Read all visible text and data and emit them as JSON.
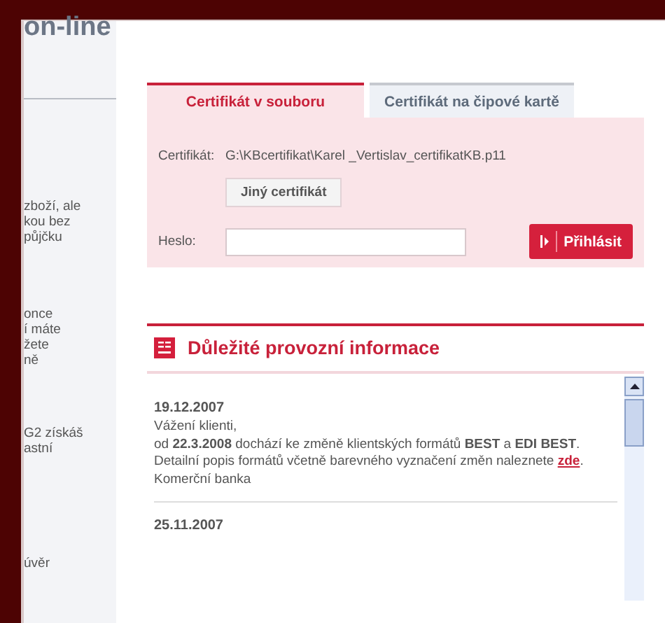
{
  "header": {
    "title": "on-line"
  },
  "sidebar": {
    "fragments": [
      {
        "lines": [
          "zboží, ale",
          "kou bez",
          "půjčku"
        ]
      },
      {
        "lines": [
          "once",
          "í máte",
          "žete",
          "ně"
        ]
      },
      {
        "lines": [
          "G2 získáš",
          "astní"
        ]
      },
      {
        "lines": [
          "úvěr"
        ]
      }
    ]
  },
  "tabs": [
    {
      "label": "Certifikát v souboru",
      "selected": true
    },
    {
      "label": "Certifikát na čipové kartě",
      "selected": false
    }
  ],
  "certificate": {
    "label": "Certifikát:",
    "value": "G:\\KBcertifikat\\Karel _Vertislav_certifikatKB.p11"
  },
  "change_button": "Jiný certifikát",
  "password": {
    "label": "Heslo:"
  },
  "login_button": "Přihlásit",
  "info": {
    "title": "Důležité provozní informace",
    "news": [
      {
        "date": "19.12.2007",
        "greeting": "Vážení klienti,",
        "text_before": "od **22.3.2008** dochází ke změně klientských formátů **BEST** a **EDI BEST**. Detailní popis formátů včetně barevného vyznačení změn naleznete",
        "link": "zde",
        "text_after": ".",
        "signature": "Komerční banka"
      },
      {
        "date": "25.11.2007"
      }
    ]
  }
}
